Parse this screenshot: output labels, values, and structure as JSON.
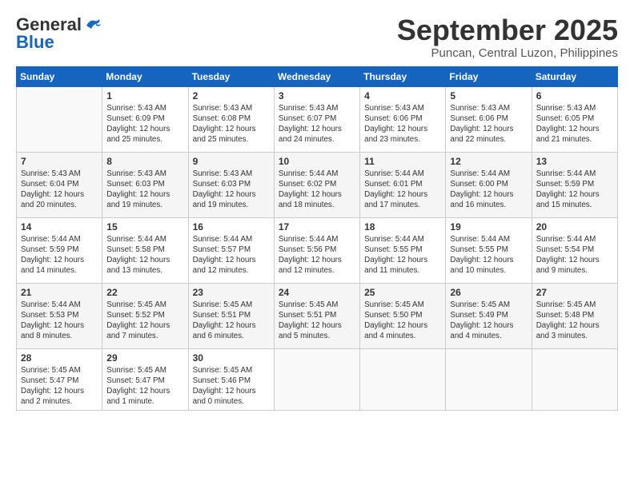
{
  "header": {
    "logo_line1": "General",
    "logo_line2": "Blue",
    "month": "September 2025",
    "location": "Puncan, Central Luzon, Philippines"
  },
  "days_of_week": [
    "Sunday",
    "Monday",
    "Tuesday",
    "Wednesday",
    "Thursday",
    "Friday",
    "Saturday"
  ],
  "weeks": [
    [
      {
        "num": "",
        "info": ""
      },
      {
        "num": "1",
        "info": "Sunrise: 5:43 AM\nSunset: 6:09 PM\nDaylight: 12 hours\nand 25 minutes."
      },
      {
        "num": "2",
        "info": "Sunrise: 5:43 AM\nSunset: 6:08 PM\nDaylight: 12 hours\nand 25 minutes."
      },
      {
        "num": "3",
        "info": "Sunrise: 5:43 AM\nSunset: 6:07 PM\nDaylight: 12 hours\nand 24 minutes."
      },
      {
        "num": "4",
        "info": "Sunrise: 5:43 AM\nSunset: 6:06 PM\nDaylight: 12 hours\nand 23 minutes."
      },
      {
        "num": "5",
        "info": "Sunrise: 5:43 AM\nSunset: 6:06 PM\nDaylight: 12 hours\nand 22 minutes."
      },
      {
        "num": "6",
        "info": "Sunrise: 5:43 AM\nSunset: 6:05 PM\nDaylight: 12 hours\nand 21 minutes."
      }
    ],
    [
      {
        "num": "7",
        "info": "Sunrise: 5:43 AM\nSunset: 6:04 PM\nDaylight: 12 hours\nand 20 minutes."
      },
      {
        "num": "8",
        "info": "Sunrise: 5:43 AM\nSunset: 6:03 PM\nDaylight: 12 hours\nand 19 minutes."
      },
      {
        "num": "9",
        "info": "Sunrise: 5:43 AM\nSunset: 6:03 PM\nDaylight: 12 hours\nand 19 minutes."
      },
      {
        "num": "10",
        "info": "Sunrise: 5:44 AM\nSunset: 6:02 PM\nDaylight: 12 hours\nand 18 minutes."
      },
      {
        "num": "11",
        "info": "Sunrise: 5:44 AM\nSunset: 6:01 PM\nDaylight: 12 hours\nand 17 minutes."
      },
      {
        "num": "12",
        "info": "Sunrise: 5:44 AM\nSunset: 6:00 PM\nDaylight: 12 hours\nand 16 minutes."
      },
      {
        "num": "13",
        "info": "Sunrise: 5:44 AM\nSunset: 5:59 PM\nDaylight: 12 hours\nand 15 minutes."
      }
    ],
    [
      {
        "num": "14",
        "info": "Sunrise: 5:44 AM\nSunset: 5:59 PM\nDaylight: 12 hours\nand 14 minutes."
      },
      {
        "num": "15",
        "info": "Sunrise: 5:44 AM\nSunset: 5:58 PM\nDaylight: 12 hours\nand 13 minutes."
      },
      {
        "num": "16",
        "info": "Sunrise: 5:44 AM\nSunset: 5:57 PM\nDaylight: 12 hours\nand 12 minutes."
      },
      {
        "num": "17",
        "info": "Sunrise: 5:44 AM\nSunset: 5:56 PM\nDaylight: 12 hours\nand 12 minutes."
      },
      {
        "num": "18",
        "info": "Sunrise: 5:44 AM\nSunset: 5:55 PM\nDaylight: 12 hours\nand 11 minutes."
      },
      {
        "num": "19",
        "info": "Sunrise: 5:44 AM\nSunset: 5:55 PM\nDaylight: 12 hours\nand 10 minutes."
      },
      {
        "num": "20",
        "info": "Sunrise: 5:44 AM\nSunset: 5:54 PM\nDaylight: 12 hours\nand 9 minutes."
      }
    ],
    [
      {
        "num": "21",
        "info": "Sunrise: 5:44 AM\nSunset: 5:53 PM\nDaylight: 12 hours\nand 8 minutes."
      },
      {
        "num": "22",
        "info": "Sunrise: 5:45 AM\nSunset: 5:52 PM\nDaylight: 12 hours\nand 7 minutes."
      },
      {
        "num": "23",
        "info": "Sunrise: 5:45 AM\nSunset: 5:51 PM\nDaylight: 12 hours\nand 6 minutes."
      },
      {
        "num": "24",
        "info": "Sunrise: 5:45 AM\nSunset: 5:51 PM\nDaylight: 12 hours\nand 5 minutes."
      },
      {
        "num": "25",
        "info": "Sunrise: 5:45 AM\nSunset: 5:50 PM\nDaylight: 12 hours\nand 4 minutes."
      },
      {
        "num": "26",
        "info": "Sunrise: 5:45 AM\nSunset: 5:49 PM\nDaylight: 12 hours\nand 4 minutes."
      },
      {
        "num": "27",
        "info": "Sunrise: 5:45 AM\nSunset: 5:48 PM\nDaylight: 12 hours\nand 3 minutes."
      }
    ],
    [
      {
        "num": "28",
        "info": "Sunrise: 5:45 AM\nSunset: 5:47 PM\nDaylight: 12 hours\nand 2 minutes."
      },
      {
        "num": "29",
        "info": "Sunrise: 5:45 AM\nSunset: 5:47 PM\nDaylight: 12 hours\nand 1 minute."
      },
      {
        "num": "30",
        "info": "Sunrise: 5:45 AM\nSunset: 5:46 PM\nDaylight: 12 hours\nand 0 minutes."
      },
      {
        "num": "",
        "info": ""
      },
      {
        "num": "",
        "info": ""
      },
      {
        "num": "",
        "info": ""
      },
      {
        "num": "",
        "info": ""
      }
    ]
  ]
}
